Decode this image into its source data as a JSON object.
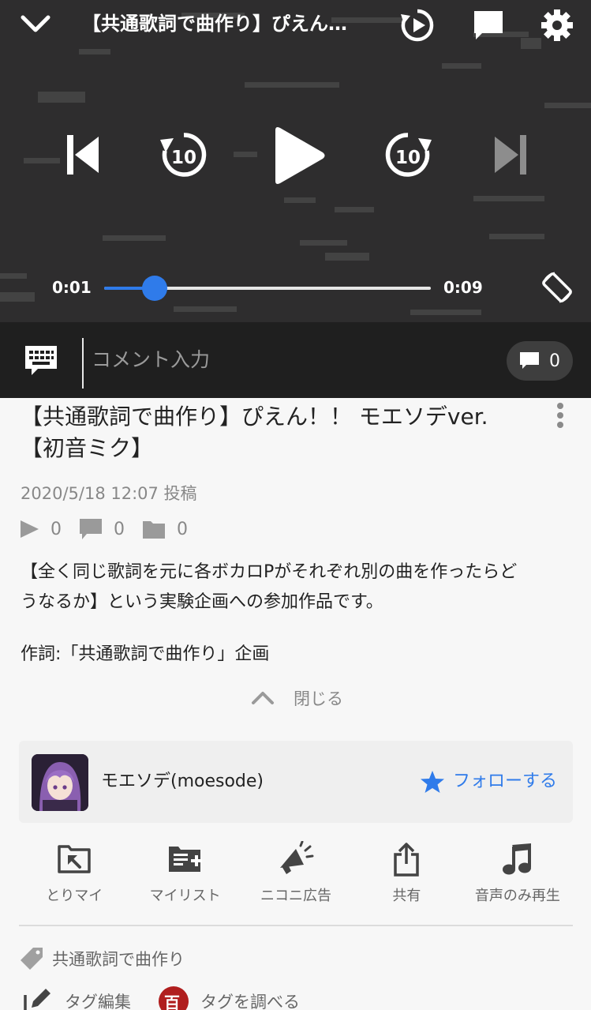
{
  "player": {
    "title": "【共通歌詞で曲作り】ぴえん…",
    "current_time": "0:01",
    "duration": "0:09",
    "progress": 0.155
  },
  "icons": {
    "collapse": "chevron-down-icon",
    "autoplay": "loop-play-icon",
    "comments_toggle": "comment-bubble-icon",
    "settings": "gear-icon",
    "previous": "skip-previous-icon",
    "rewind": "rewind-10-icon",
    "play": "play-icon",
    "forward": "forward-10-icon",
    "next": "skip-next-icon",
    "rotate": "rotate-screen-icon",
    "keyboard": "comment-keyboard-icon"
  },
  "comment_bar": {
    "placeholder": "コメント入力",
    "count": "0"
  },
  "video": {
    "title_line1": "【共通歌詞で曲作り】ぴえん！！ モエソデver.",
    "title_line2": "【初音ミク】",
    "posted": "2020/5/18 12:07 投稿",
    "views": "0",
    "comments": "0",
    "mylists": "0",
    "description": [
      "【全く同じ歌詞を元に各ボカロPがそれぞれ別の曲を作ったらど",
      "うなるか】という実験企画への参加作品です。",
      "作詞:「共通歌詞で曲作り」企画"
    ],
    "close_label": "閉じる"
  },
  "uploader": {
    "name": "モエソデ(moesode)",
    "follow_label": "フォローする"
  },
  "actions": [
    {
      "label": "とりマイ",
      "icon": "quick-mylist-icon"
    },
    {
      "label": "マイリスト",
      "icon": "mylist-add-icon"
    },
    {
      "label": "ニコニ広告",
      "icon": "megaphone-icon"
    },
    {
      "label": "共有",
      "icon": "share-icon"
    },
    {
      "label": "音声のみ再生",
      "icon": "music-note-icon"
    }
  ],
  "tags": {
    "items": [
      "共通歌詞で曲作り"
    ],
    "edit_label": "タグ編集",
    "search_label": "タグを調べる",
    "search_badge": "百"
  },
  "colors": {
    "accent": "#2f7bea",
    "player_bg": "#2e2d2e",
    "comment_bar_bg": "#1f1f1f",
    "badge": "#b01e1e"
  }
}
